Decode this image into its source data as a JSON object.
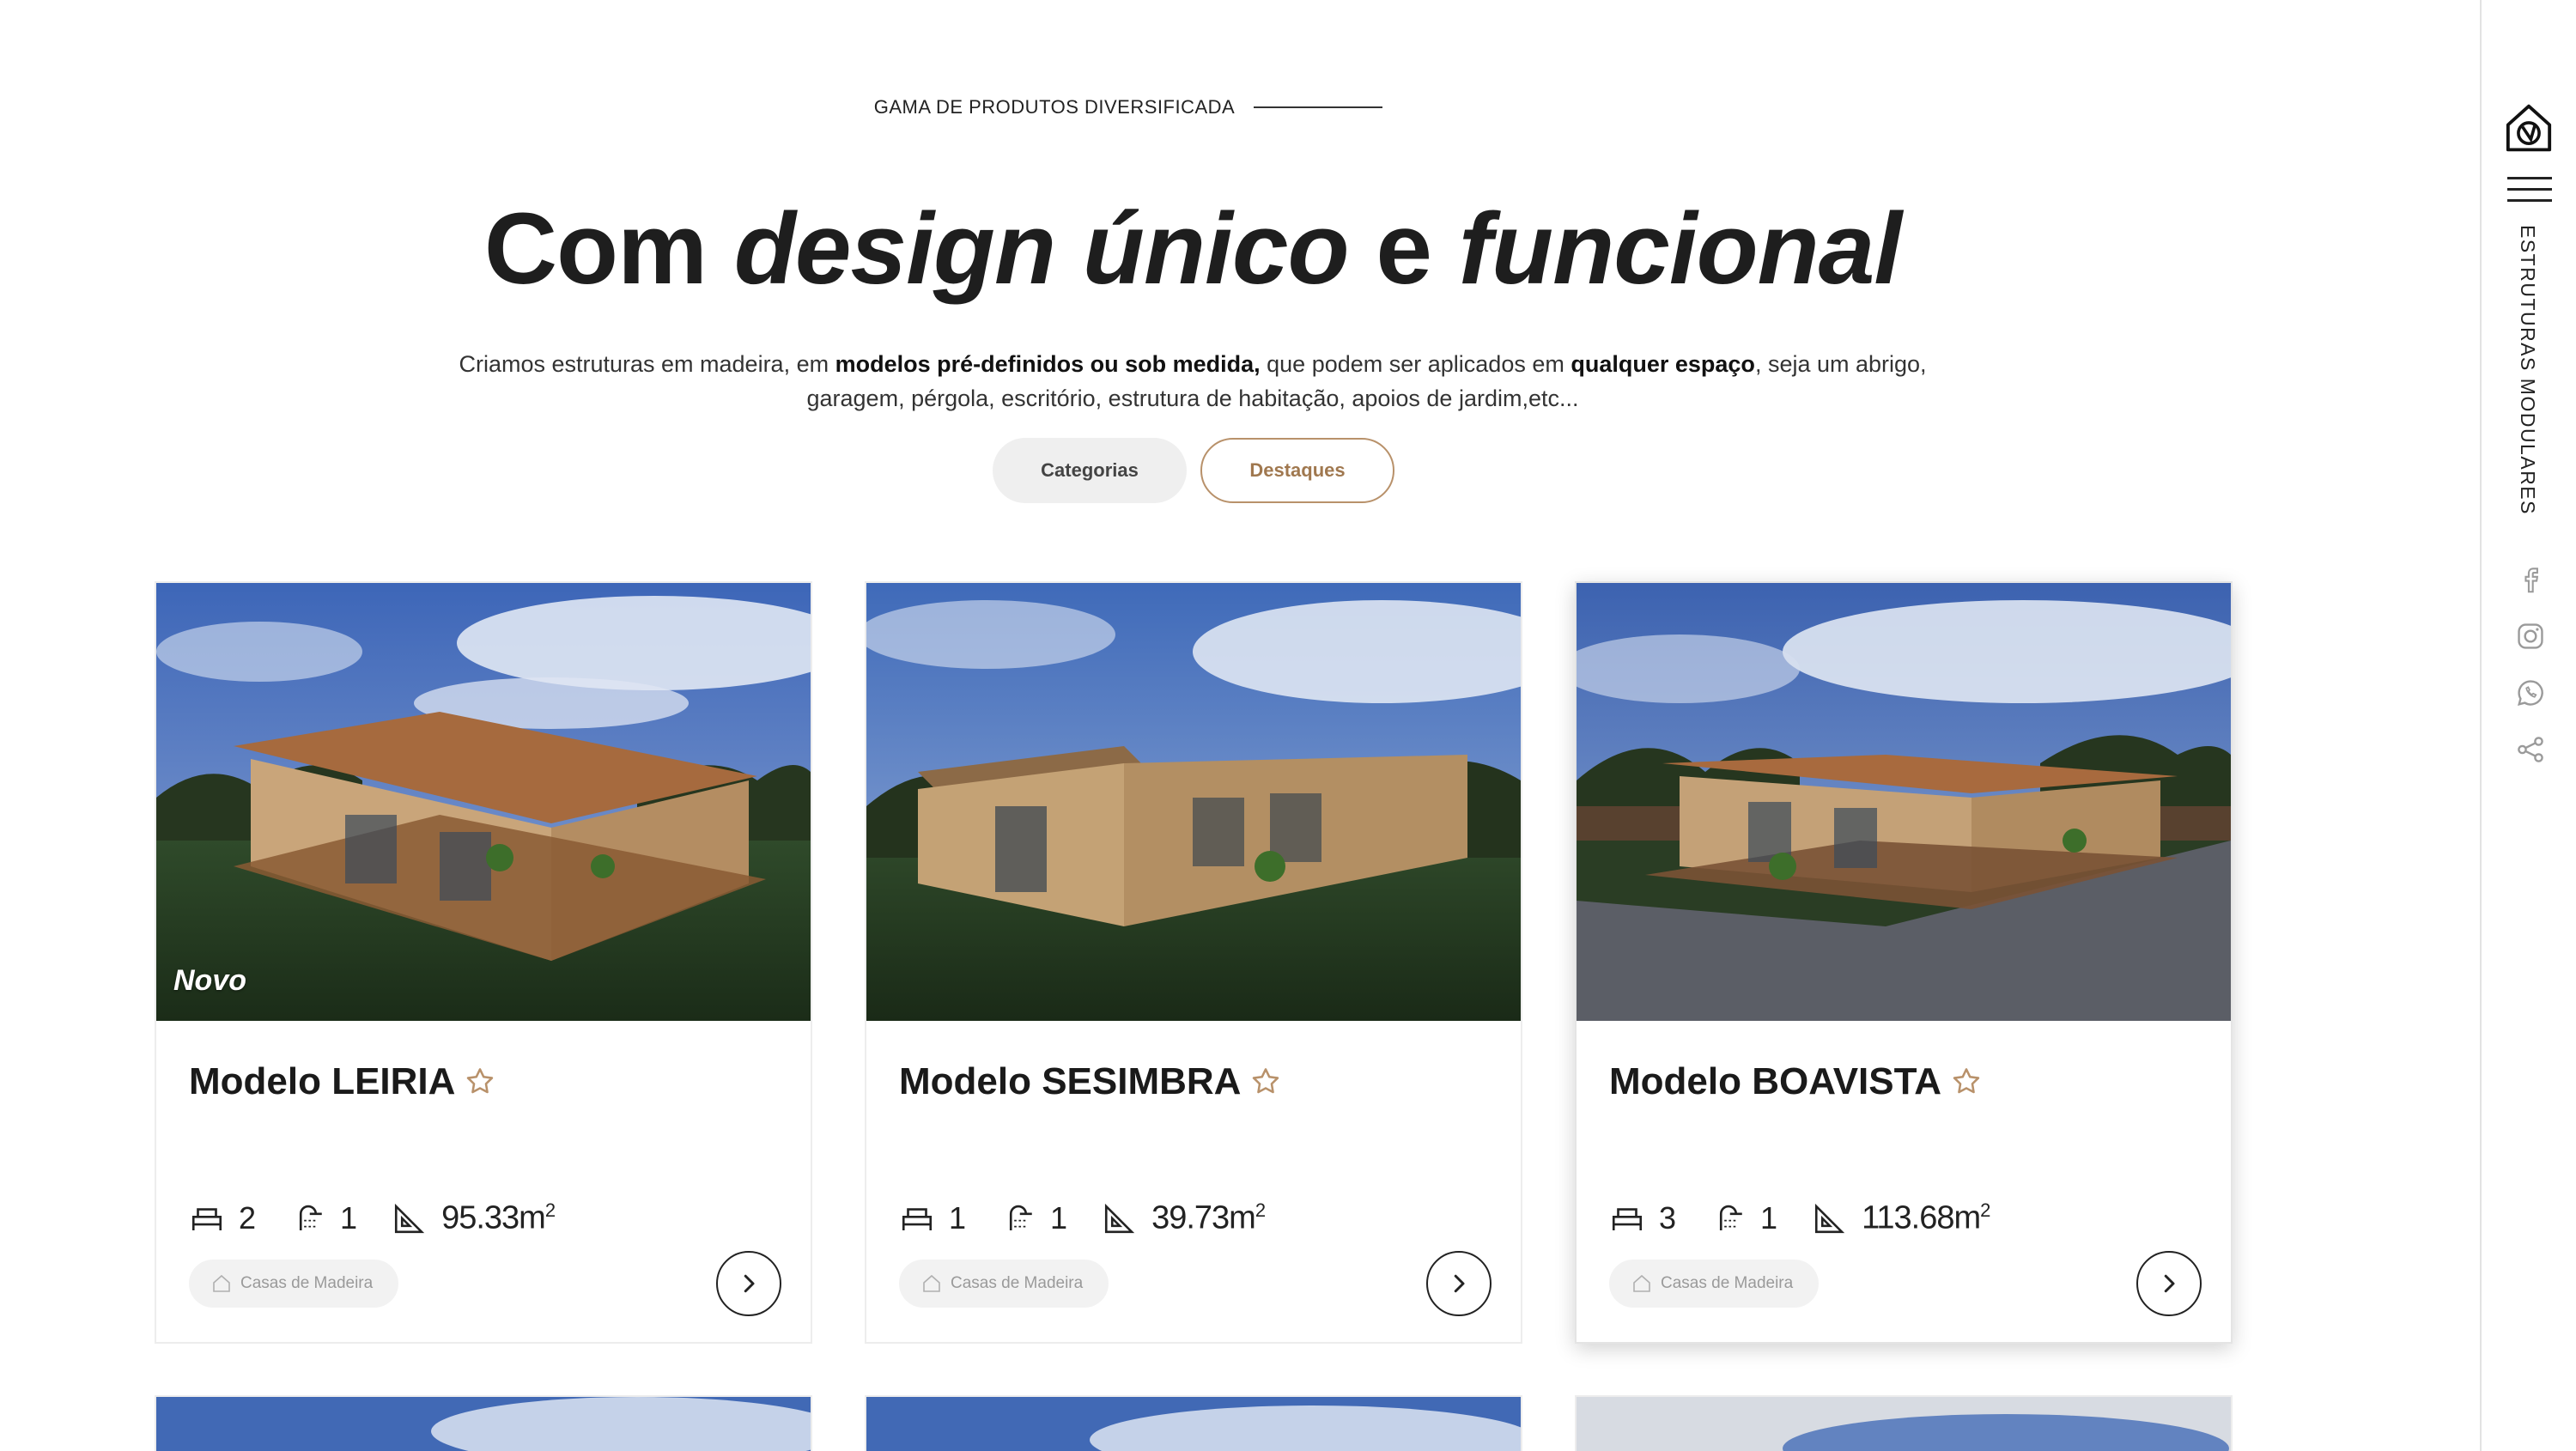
{
  "header": {
    "eyebrow": "GAMA DE PRODUTOS DIVERSIFICADA",
    "headline_plain_1": "Com ",
    "headline_italic_1": "design único",
    "headline_plain_2": " e ",
    "headline_italic_2": "funcional",
    "intro_1": "Criamos estruturas em madeira, em ",
    "intro_bold_1": "modelos pré-definidos ou sob medida,",
    "intro_2": " que podem ser aplicados em ",
    "intro_bold_2": "qualquer espaço",
    "intro_3": ", seja um abrigo, garagem, pérgola, escritório, estrutura de habitação, apoios de jardim,etc..."
  },
  "tabs": [
    {
      "label": "Categorias",
      "active": false
    },
    {
      "label": "Destaques",
      "active": true
    }
  ],
  "cards": [
    {
      "title": "Modelo LEIRIA",
      "badge": "Novo",
      "bedrooms": "2",
      "bathrooms": "1",
      "area": "95.33m",
      "area_unit": "2",
      "category": "Casas de Madeira"
    },
    {
      "title": "Modelo SESIMBRA",
      "badge": "",
      "bedrooms": "1",
      "bathrooms": "1",
      "area": "39.73m",
      "area_unit": "2",
      "category": "Casas de Madeira"
    },
    {
      "title": "Modelo BOAVISTA",
      "badge": "",
      "bedrooms": "3",
      "bathrooms": "1",
      "area": "113.68m",
      "area_unit": "2",
      "category": "Casas de Madeira"
    }
  ],
  "rail": {
    "vertical_label": "ESTRUTURAS MODULARES",
    "social_icons": [
      "facebook-icon",
      "instagram-icon",
      "whatsapp-icon",
      "share-icon"
    ]
  },
  "colors": {
    "accent": "#a0784f",
    "text": "#1e1e1e",
    "chip_bg": "#f2f2f2"
  }
}
